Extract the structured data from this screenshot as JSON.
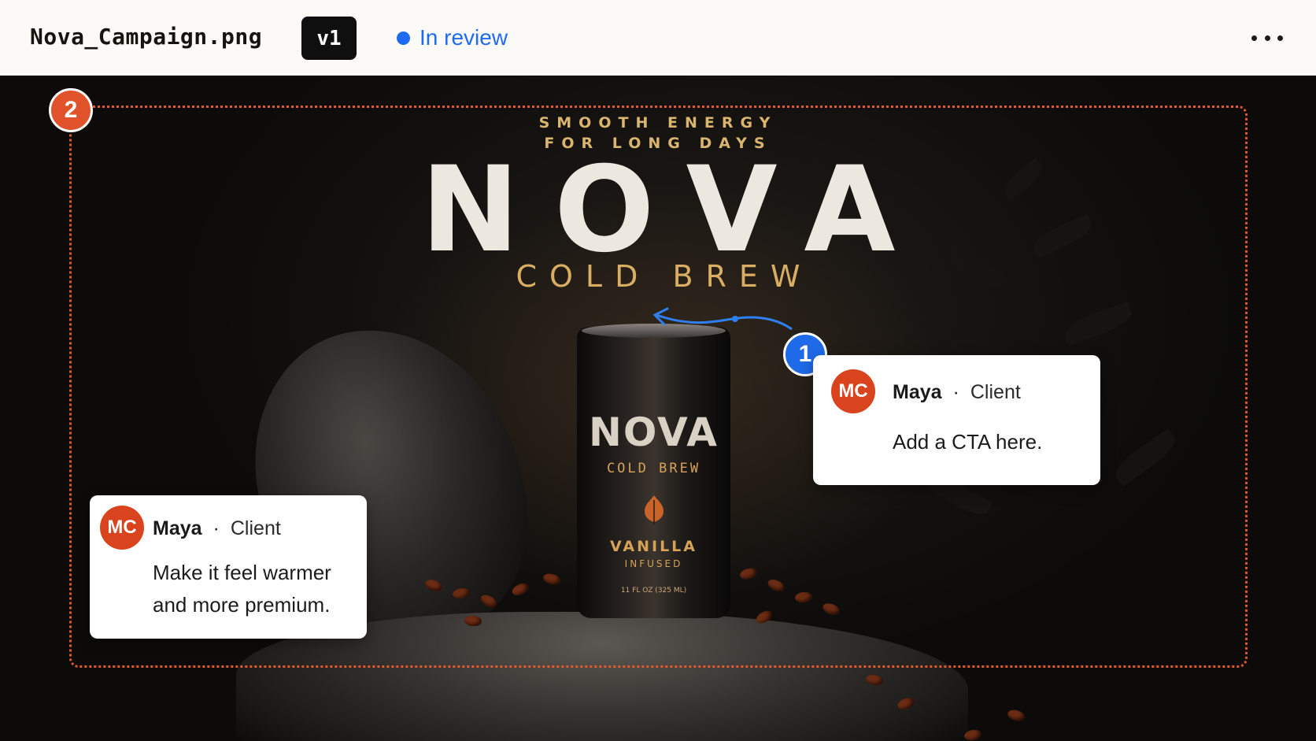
{
  "header": {
    "filename": "Nova_Campaign.png",
    "version": "v1",
    "status": "In review",
    "status_color": "#1e6af0",
    "more_icon": "more-horizontal-icon"
  },
  "artwork": {
    "tagline_line1": "SMOOTH ENERGY",
    "tagline_line2": "FOR LONG DAYS",
    "headline": "NOVA",
    "subhead": "COLD BREW",
    "can": {
      "name": "NOVA",
      "subtitle": "COLD BREW",
      "flavor": "VANILLA",
      "flavor_detail": "INFUSED",
      "volume": "11 FL OZ (325 ML)"
    }
  },
  "annotations": {
    "region_pin": "2",
    "region_color": "#e05a2c",
    "point_pin": "1",
    "point_color": "#1f6ae8"
  },
  "comments": [
    {
      "initials": "MC",
      "author": "Maya",
      "separator": "·",
      "role": "Client",
      "text": "Add a CTA here."
    },
    {
      "initials": "MC",
      "author": "Maya",
      "separator": "·",
      "role": "Client",
      "text_line1": "Make it feel warmer",
      "text_line2": "and more premium."
    }
  ]
}
